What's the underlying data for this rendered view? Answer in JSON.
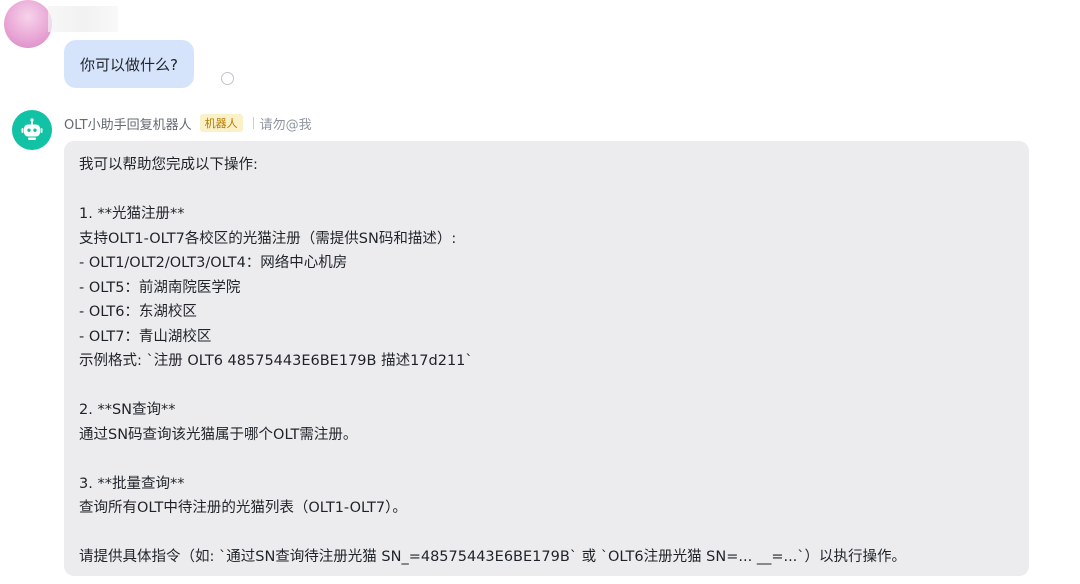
{
  "user_message": {
    "text": "你可以做什么?"
  },
  "bot": {
    "name": "OLT小助手回复机器人",
    "badge": "机器人",
    "mention": "请勿@我",
    "icon": "robot-icon",
    "accent_color": "#12c2a4"
  },
  "bot_message": {
    "lines": [
      "我可以帮助您完成以下操作:",
      "",
      "1. **光猫注册**",
      "支持OLT1-OLT7各校区的光猫注册（需提供SN码和描述）:",
      "- OLT1/OLT2/OLT3/OLT4：网络中心机房",
      "- OLT5：前湖南院医学院",
      "- OLT6：东湖校区",
      "- OLT7：青山湖校区",
      "示例格式: `注册 OLT6 48575443E6BE179B 描述17d211`",
      "",
      "2. **SN查询**",
      "通过SN码查询该光猫属于哪个OLT需注册。",
      "",
      "3. **批量查询**",
      "查询所有OLT中待注册的光猫列表（OLT1-OLT7）。",
      "",
      "请提供具体指令（如: `通过SN查询待注册光猫 SN_=48575443E6BE179B` 或 `OLT6注册光猫 SN=... __=...`）以执行操作。"
    ]
  }
}
